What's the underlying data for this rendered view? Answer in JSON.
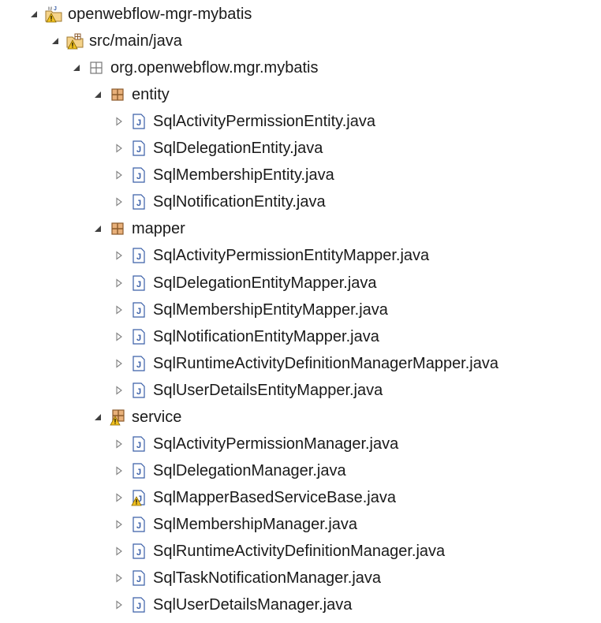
{
  "project": {
    "label": "openwebflow-mgr-mybatis",
    "expanded": true,
    "icon": "java-project-icon",
    "source_folder": {
      "label": "src/main/java",
      "expanded": true,
      "icon": "source-folder-icon",
      "root_package": {
        "label": "org.openwebflow.mgr.mybatis",
        "expanded": true,
        "icon": "empty-package-icon",
        "packages": [
          {
            "label": "entity",
            "expanded": true,
            "icon": "package-icon",
            "files": [
              {
                "label": "SqlActivityPermissionEntity.java",
                "icon": "java-file-icon"
              },
              {
                "label": "SqlDelegationEntity.java",
                "icon": "java-file-icon"
              },
              {
                "label": "SqlMembershipEntity.java",
                "icon": "java-file-icon"
              },
              {
                "label": "SqlNotificationEntity.java",
                "icon": "java-file-icon"
              }
            ]
          },
          {
            "label": "mapper",
            "expanded": true,
            "icon": "package-icon",
            "files": [
              {
                "label": "SqlActivityPermissionEntityMapper.java",
                "icon": "java-file-icon"
              },
              {
                "label": "SqlDelegationEntityMapper.java",
                "icon": "java-file-icon"
              },
              {
                "label": "SqlMembershipEntityMapper.java",
                "icon": "java-file-icon"
              },
              {
                "label": "SqlNotificationEntityMapper.java",
                "icon": "java-file-icon"
              },
              {
                "label": "SqlRuntimeActivityDefinitionManagerMapper.java",
                "icon": "java-file-icon"
              },
              {
                "label": "SqlUserDetailsEntityMapper.java",
                "icon": "java-file-icon"
              }
            ]
          },
          {
            "label": "service",
            "expanded": true,
            "icon": "package-warning-icon",
            "files": [
              {
                "label": "SqlActivityPermissionManager.java",
                "icon": "java-file-icon"
              },
              {
                "label": "SqlDelegationManager.java",
                "icon": "java-file-icon"
              },
              {
                "label": "SqlMapperBasedServiceBase.java",
                "icon": "java-file-warning-icon"
              },
              {
                "label": "SqlMembershipManager.java",
                "icon": "java-file-icon"
              },
              {
                "label": "SqlRuntimeActivityDefinitionManager.java",
                "icon": "java-file-icon"
              },
              {
                "label": "SqlTaskNotificationManager.java",
                "icon": "java-file-icon"
              },
              {
                "label": "SqlUserDetailsManager.java",
                "icon": "java-file-icon"
              }
            ]
          }
        ]
      }
    }
  },
  "colors": {
    "package_brown": "#8b5a2b",
    "java_file_blue": "#3a5fa8",
    "warning_yellow": "#f0c020",
    "twisty_gray": "#808080",
    "text": "#1a1a1a"
  }
}
